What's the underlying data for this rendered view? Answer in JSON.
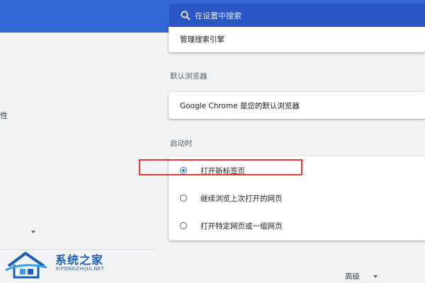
{
  "search": {
    "placeholder": "在设置中搜索"
  },
  "sidebar": {
    "fragment_text": "性"
  },
  "search_engine": {
    "manage_label": "管理搜索引擎"
  },
  "default_browser": {
    "title": "默认浏览器",
    "status_text": "Google Chrome 是您的默认浏览器"
  },
  "startup": {
    "title": "启动时",
    "options": [
      {
        "label": "打开新标签页",
        "selected": true
      },
      {
        "label": "继续浏览上次打开的网页",
        "selected": false
      },
      {
        "label": "打开特定网页或一组网页",
        "selected": false
      }
    ]
  },
  "advanced": {
    "label": "高级"
  },
  "watermark": {
    "title": "系统之家",
    "subtitle": "XITONGZHIJIA.NET"
  },
  "colors": {
    "header": "#3367d6",
    "search_box": "#2a56c6",
    "radio_selected": "#1a73e8",
    "highlight": "#e53935",
    "page_bg": "#f1f3f4"
  }
}
